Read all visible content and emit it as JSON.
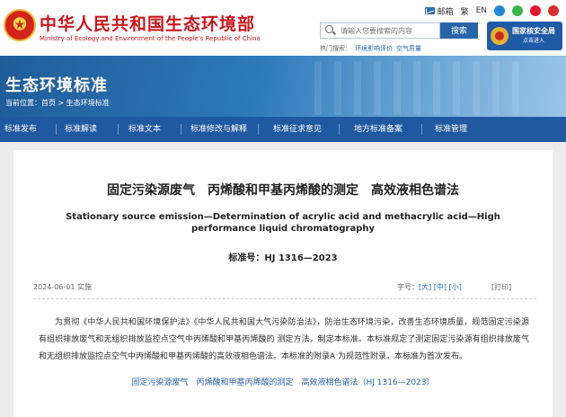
{
  "header": {
    "ministry_cn": "中华人民共和国生态环境部",
    "ministry_en": "Ministry of Ecology and Environment of the People's Republic of China",
    "toplinks": {
      "mail": "邮箱",
      "traditional": "繁",
      "english": "EN"
    },
    "search": {
      "placeholder": "请输入您要搜索的内容",
      "button": "搜索"
    },
    "hot_label": "热门搜索：",
    "hot_terms": [
      "环境影响评价",
      "空气质量"
    ],
    "nsa": {
      "line1": "国家核安全局",
      "line2": "点击进入"
    }
  },
  "banner": {
    "title": "生态环境标准",
    "breadcrumb": "当前位置：首页 > 生态环境标准"
  },
  "nav": {
    "items": [
      "标准发布",
      "标准解读",
      "标准文本",
      "标准修改与解释",
      "标准征求意见",
      "地方标准备案",
      "标准管理"
    ]
  },
  "article": {
    "title_cn": "固定污染源废气　丙烯酸和甲基丙烯酸的测定　高效液相色谱法",
    "title_en": "Stationary source emission—Determination of acrylic acid and methacrylic acid—High performance liquid chromatography",
    "std_no": "标准号：HJ 1316—2023",
    "date": "2024-06-01 实施",
    "font_label": "字号：",
    "font_large": "[大]",
    "font_medium": "[中]",
    "font_small": "[小]",
    "print": "[打印]",
    "body": "为贯彻《中华人民共和国环境保护法》《中华人民共和国大气污染防治法》，防治生态环境污染，改善生态环境质量，规范固定污染源有组织排放废气和无组织排放监控点空气中丙烯酸和甲基丙烯酸的 测定方法，制定本标准。本标准规定了测定固定污染源有组织排放废气和无组织排放监控点空气中丙烯酸和甲基丙烯酸的高效液相色谱法。本标准的附录A 为规范性附录。本标准为首次发布。",
    "doc_link": "固定污染源废气　丙烯酸和甲基丙烯酸的测定　高效液相色谱法（HJ 1316—2023）"
  }
}
